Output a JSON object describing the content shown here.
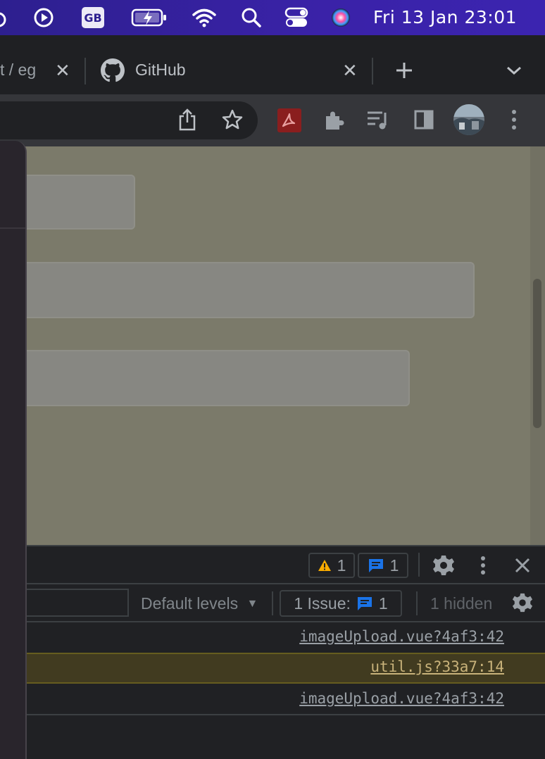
{
  "menubar": {
    "keyboard_badge": "GB",
    "clock": "Fri 13 Jan  23:01"
  },
  "tabs": [
    {
      "label": "t / eg",
      "closable": true
    },
    {
      "label": "GitHub",
      "closable": true
    }
  ],
  "toolbar": {
    "icons": [
      "share-icon",
      "bookmark-star-icon",
      "adobe-acrobat-icon",
      "extensions-puzzle-icon",
      "media-queue-icon",
      "side-panel-icon",
      "profile-avatar",
      "more-menu-icon"
    ]
  },
  "devtools": {
    "warnings_count": "1",
    "messages_count": "1",
    "default_levels": "Default levels",
    "issues_label": "1 Issue:",
    "issues_count": "1",
    "hidden_label": "1 hidden",
    "console_rows": [
      {
        "source": "imageUpload.vue?4af3:42",
        "level": "log"
      },
      {
        "source": "util.js?33a7:14",
        "level": "warning"
      },
      {
        "source": "imageUpload.vue?4af3:42",
        "level": "log"
      }
    ]
  },
  "colors": {
    "menubar": "#3a22a8",
    "warning_row_bg": "#413b20",
    "info_blue": "#1a73e8",
    "warning_yellow": "#f9ab00"
  }
}
